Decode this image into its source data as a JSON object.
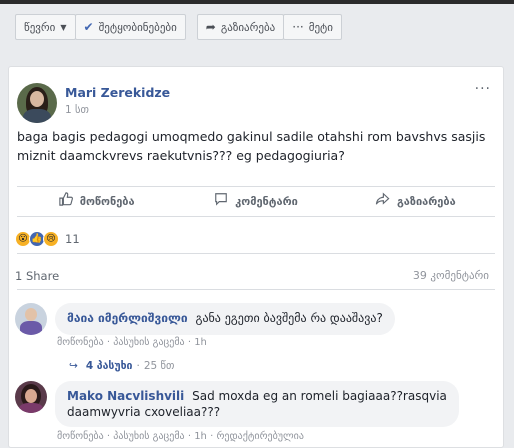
{
  "toolbar": {
    "sort_label": "წევრი",
    "follow_label": "შეტყობინებები",
    "share_label": "გაზიარება",
    "more_label": "მეტი"
  },
  "post": {
    "author": "Mari Zerekidze",
    "time": "1 სთ",
    "text": "baga bagis pedagogi umoqmedo gakinul sadile otahshi rom bavshvs sasjis miznit daamckvrevs raekutvnis??? eg pedagogiuria?",
    "more": "···"
  },
  "actions": {
    "like": "მოწონება",
    "comment": "კომენტარი",
    "share": "გაზიარება"
  },
  "reactions": {
    "count": "11"
  },
  "stats": {
    "shares": "1 Share",
    "comments": "39 კომენტარი"
  },
  "comments": [
    {
      "name": "მაია იმერლიშვილი",
      "text": "განა ეგეთი ბავშემა რა დააშავა?",
      "meta_like": "მოწონება",
      "meta_reply": "პასუხის გაცემა",
      "meta_time": "1h"
    },
    {
      "name": "Mako Nacvlishvili",
      "text": "Sad moxda eg an romeli bagiaaa??rasqvia daamwyvria cxoveliaa???",
      "meta_like": "მოწონება",
      "meta_reply": "პასუხის გაცემა",
      "meta_time": "1h",
      "meta_extra": "რედაქტირებულია"
    }
  ],
  "replies": {
    "label": "4 პასუხი",
    "time": "25 წთ"
  }
}
